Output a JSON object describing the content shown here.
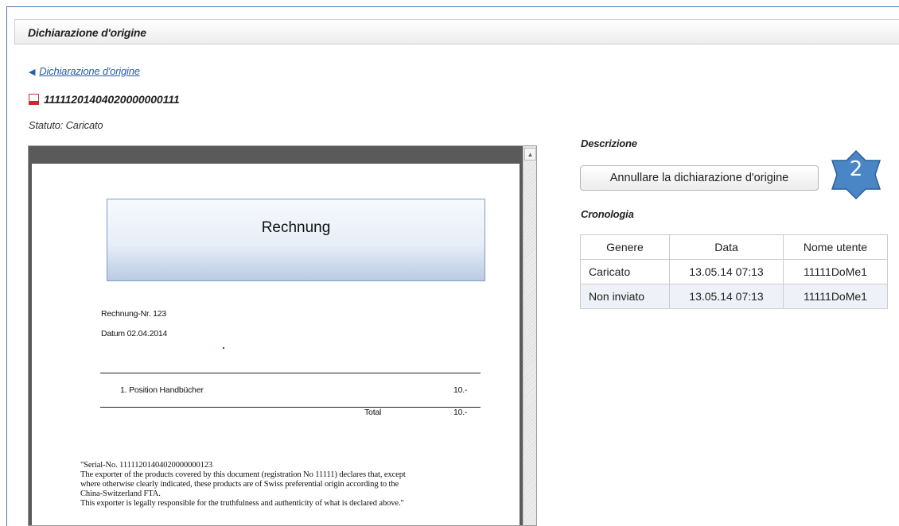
{
  "header": {
    "title": "Dichiarazione d'origine"
  },
  "back_link": {
    "label": "Dichiarazione d'origine"
  },
  "file": {
    "icon": "pdf-icon",
    "name": "11111201404020000000111"
  },
  "status": "Statuto: Caricato",
  "invoice": {
    "title": "Rechnung",
    "number": "Rechnung-Nr. 123",
    "date": "Datum 02.04.2014",
    "position_label": "1.   Position Handbücher",
    "position_amount": "10.-",
    "total_label": "Total",
    "total_amount": "10.-",
    "declaration": [
      "\"Serial-No. 11111201404020000000123",
      "The exporter of the products covered by this document (registration No 11111) declares that, except",
      "where otherwise clearly indicated, these products are of Swiss preferential origin according to the",
      "China-Switzerland FTA.",
      "This exporter is legally responsible for the truthfulness and authenticity of what is declared above.\""
    ]
  },
  "description": {
    "label": "Descrizione",
    "cancel_button": "Annullare la dichiarazione d'origine"
  },
  "badge": {
    "number": "2",
    "color": "#4a86c5"
  },
  "history": {
    "label": "Cronologia",
    "columns": [
      "Genere",
      "Data",
      "Nome utente"
    ],
    "rows": [
      [
        "Caricato",
        "13.05.14 07:13",
        "11111DoMe1"
      ],
      [
        "Non inviato",
        "13.05.14 07:13",
        "11111DoMe1"
      ]
    ]
  }
}
